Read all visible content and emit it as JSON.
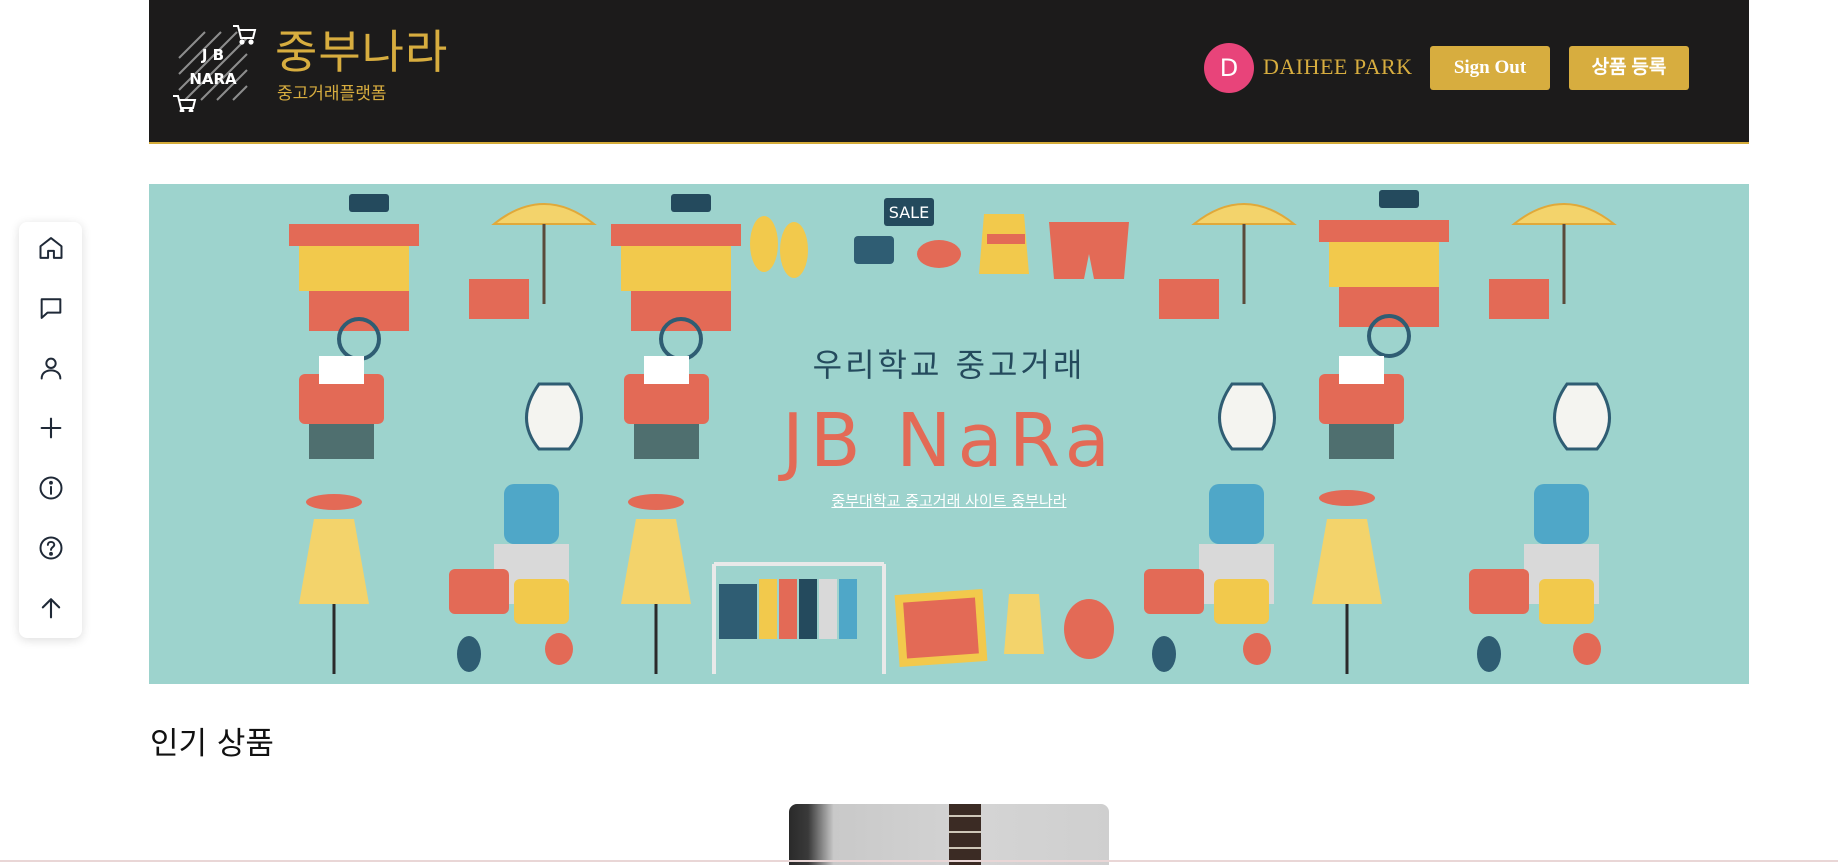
{
  "header": {
    "brand_title": "중부나라",
    "brand_subtitle": "중고거래플랫폼",
    "logo_text_top": "J B",
    "logo_text_bottom": "NARA",
    "user_initial": "D",
    "user_name": "DAIHEE PARK",
    "sign_out_label": "Sign Out",
    "register_label": "상품 등록"
  },
  "side_nav": {
    "items": [
      {
        "icon": "home-icon"
      },
      {
        "icon": "chat-icon"
      },
      {
        "icon": "user-icon"
      },
      {
        "icon": "plus-icon"
      },
      {
        "icon": "info-icon"
      },
      {
        "icon": "help-icon"
      },
      {
        "icon": "arrow-up-icon"
      }
    ]
  },
  "banner": {
    "line1": "우리학교 중고거래",
    "line2": "JB NaRa",
    "line3": "중부대학교 중고거래 사이트 중부나라",
    "sale_tag": "SALE"
  },
  "main": {
    "section_title": "인기 상품"
  },
  "colors": {
    "header_bg": "#1c1b1b",
    "accent_gold": "#d7ad3f",
    "avatar_pink": "#e8447a",
    "banner_bg": "#9dd3cd",
    "banner_red": "#e36a56"
  }
}
